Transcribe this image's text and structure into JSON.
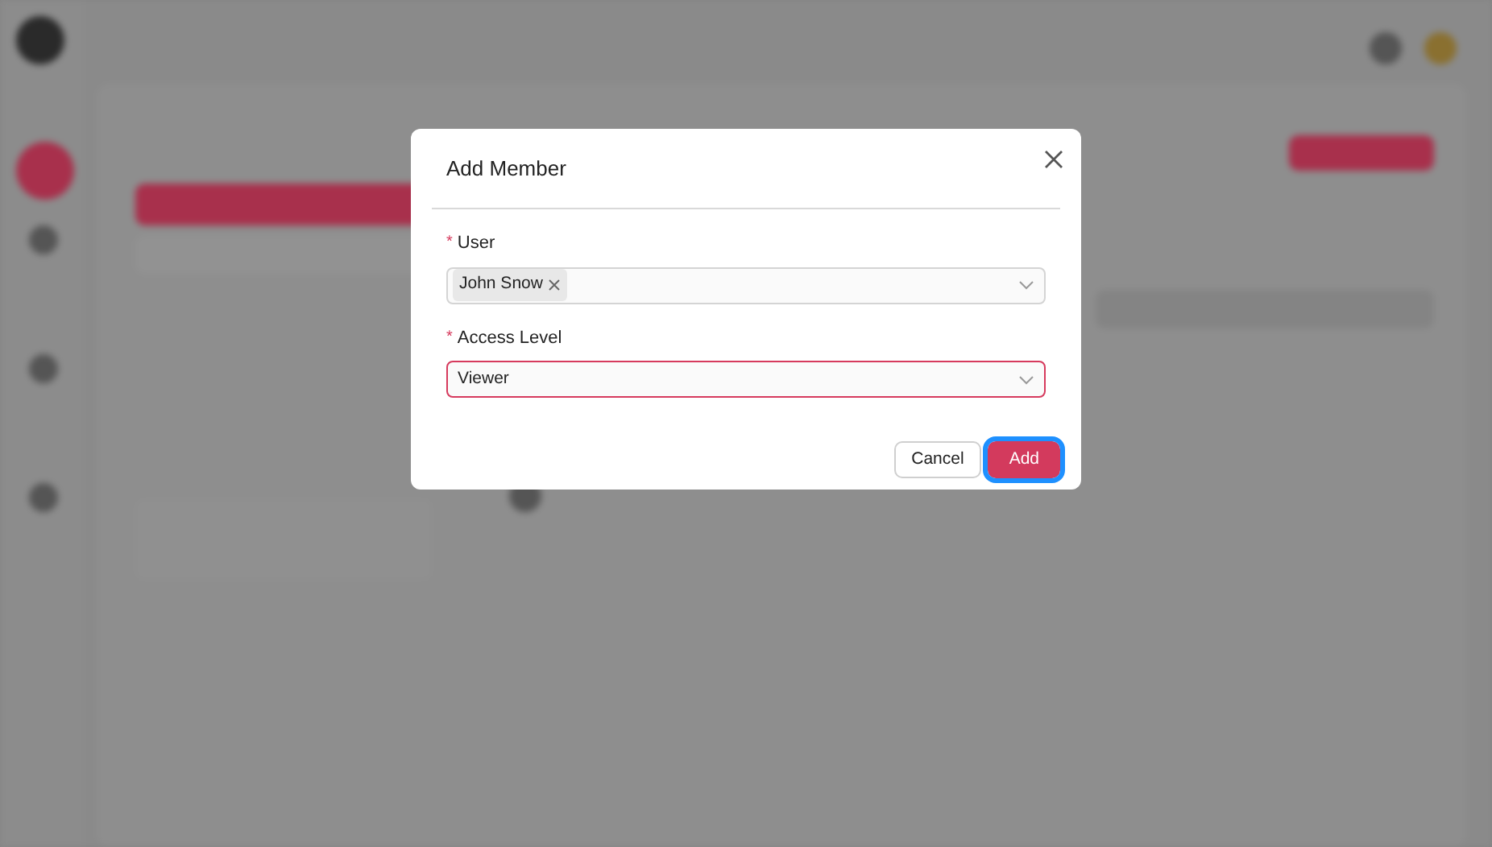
{
  "dialog": {
    "title": "Add Member",
    "fields": [
      {
        "kind": "tags",
        "required_mark": "*",
        "label": "User",
        "tags": [
          {
            "label": "John Snow"
          }
        ],
        "focused": false
      },
      {
        "kind": "select",
        "required_mark": "*",
        "label": "Access Level",
        "value": "Viewer",
        "focused": true
      }
    ],
    "buttons": [
      {
        "label": "Cancel",
        "kind": "secondary",
        "focused": false
      },
      {
        "label": "Add",
        "kind": "primary",
        "focused": true
      }
    ]
  }
}
